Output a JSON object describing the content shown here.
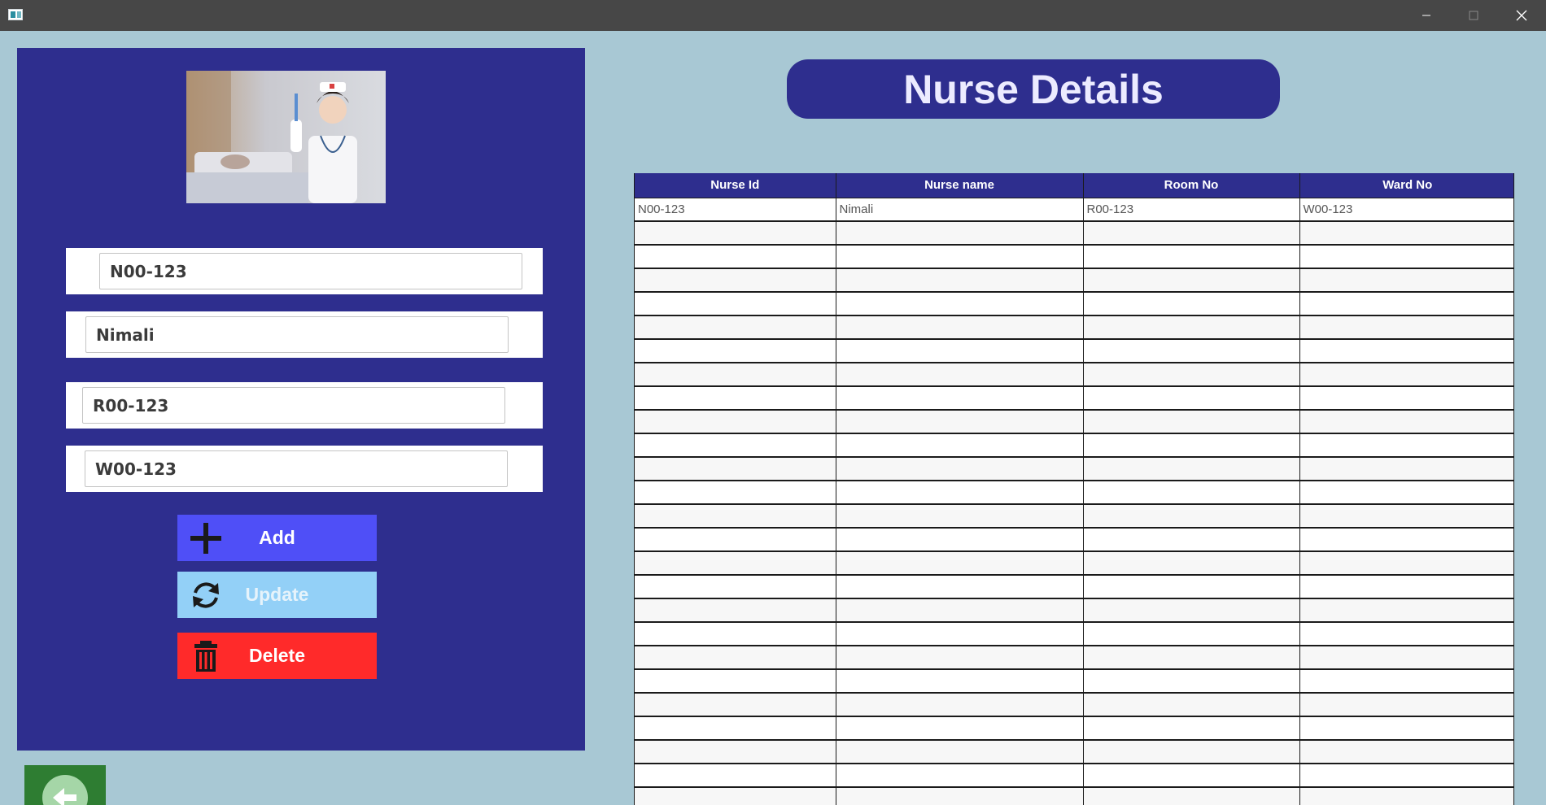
{
  "window": {
    "app_icon": "window-app-icon",
    "controls": [
      "minimize-icon",
      "maximize-icon",
      "close-icon"
    ]
  },
  "form": {
    "nurse_id": "N00-123",
    "nurse_name": "Nimali",
    "room_no": "R00-123",
    "ward_no": "W00-123"
  },
  "buttons": {
    "add_label": "Add",
    "update_label": "Update",
    "delete_label": "Delete"
  },
  "header": {
    "title": "Nurse Details"
  },
  "table": {
    "columns": [
      "Nurse Id",
      "Nurse name",
      "Room No",
      "Ward No"
    ],
    "rows": [
      [
        "N00-123",
        "Nimali",
        "R00-123",
        "W00-123"
      ]
    ]
  },
  "colors": {
    "panel": "#2e2e8e",
    "background": "#a8c8d4",
    "add": "#4f4ff7",
    "update": "#93d0f7",
    "delete": "#ff2a2a",
    "back": "#2e7d32"
  }
}
